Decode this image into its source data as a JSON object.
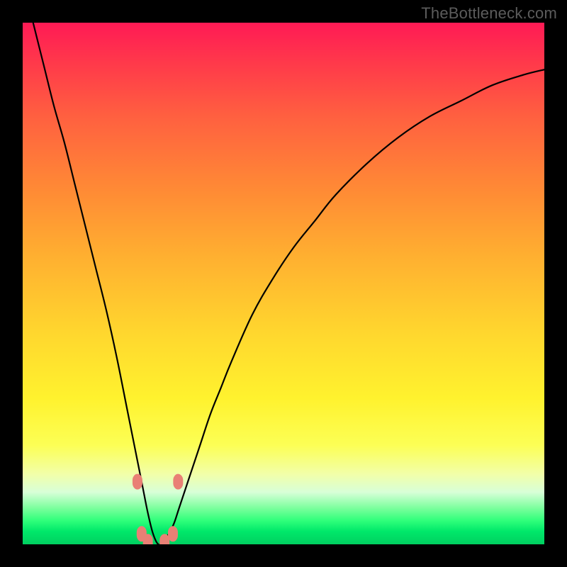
{
  "watermark": "TheBottleneck.com",
  "colors": {
    "frame": "#000000",
    "curve": "#000000",
    "marker": "#e98075",
    "gradient_stops": [
      {
        "pct": 0,
        "hex": "#ff1a55"
      },
      {
        "pct": 18,
        "hex": "#ff6040"
      },
      {
        "pct": 45,
        "hex": "#ffb030"
      },
      {
        "pct": 72,
        "hex": "#fff22e"
      },
      {
        "pct": 90,
        "hex": "#d8ffd8"
      },
      {
        "pct": 100,
        "hex": "#00d060"
      }
    ]
  },
  "chart_data": {
    "type": "line",
    "title": "",
    "xlabel": "",
    "ylabel": "",
    "xlim": [
      0,
      100
    ],
    "ylim": [
      0,
      100
    ],
    "grid": false,
    "note": "V-shaped bottleneck curve on rainbow gradient. Minimum (best match) near x≈26 at y≈0; curve rises steeply on both sides. Percent values estimated from pixel geometry.",
    "series": [
      {
        "name": "bottleneck-curve",
        "x": [
          2,
          4,
          6,
          8,
          10,
          12,
          14,
          16,
          18,
          20,
          21,
          22,
          23,
          24,
          25,
          26,
          27,
          28,
          29,
          30,
          32,
          34,
          36,
          38,
          40,
          44,
          48,
          52,
          56,
          60,
          66,
          72,
          78,
          84,
          90,
          96,
          100
        ],
        "y": [
          100,
          92,
          84,
          77,
          69,
          61,
          53,
          45,
          36,
          26,
          21,
          16,
          11,
          6,
          2,
          0,
          0.5,
          2,
          4,
          7,
          13,
          19,
          25,
          30,
          35,
          44,
          51,
          57,
          62,
          67,
          73,
          78,
          82,
          85,
          88,
          90,
          91
        ]
      }
    ],
    "markers": [
      {
        "x": 22.0,
        "y": 12.0
      },
      {
        "x": 22.8,
        "y": 2.0
      },
      {
        "x": 24.0,
        "y": 0.5
      },
      {
        "x": 27.2,
        "y": 0.5
      },
      {
        "x": 28.8,
        "y": 2.0
      },
      {
        "x": 29.8,
        "y": 12.0
      }
    ]
  }
}
